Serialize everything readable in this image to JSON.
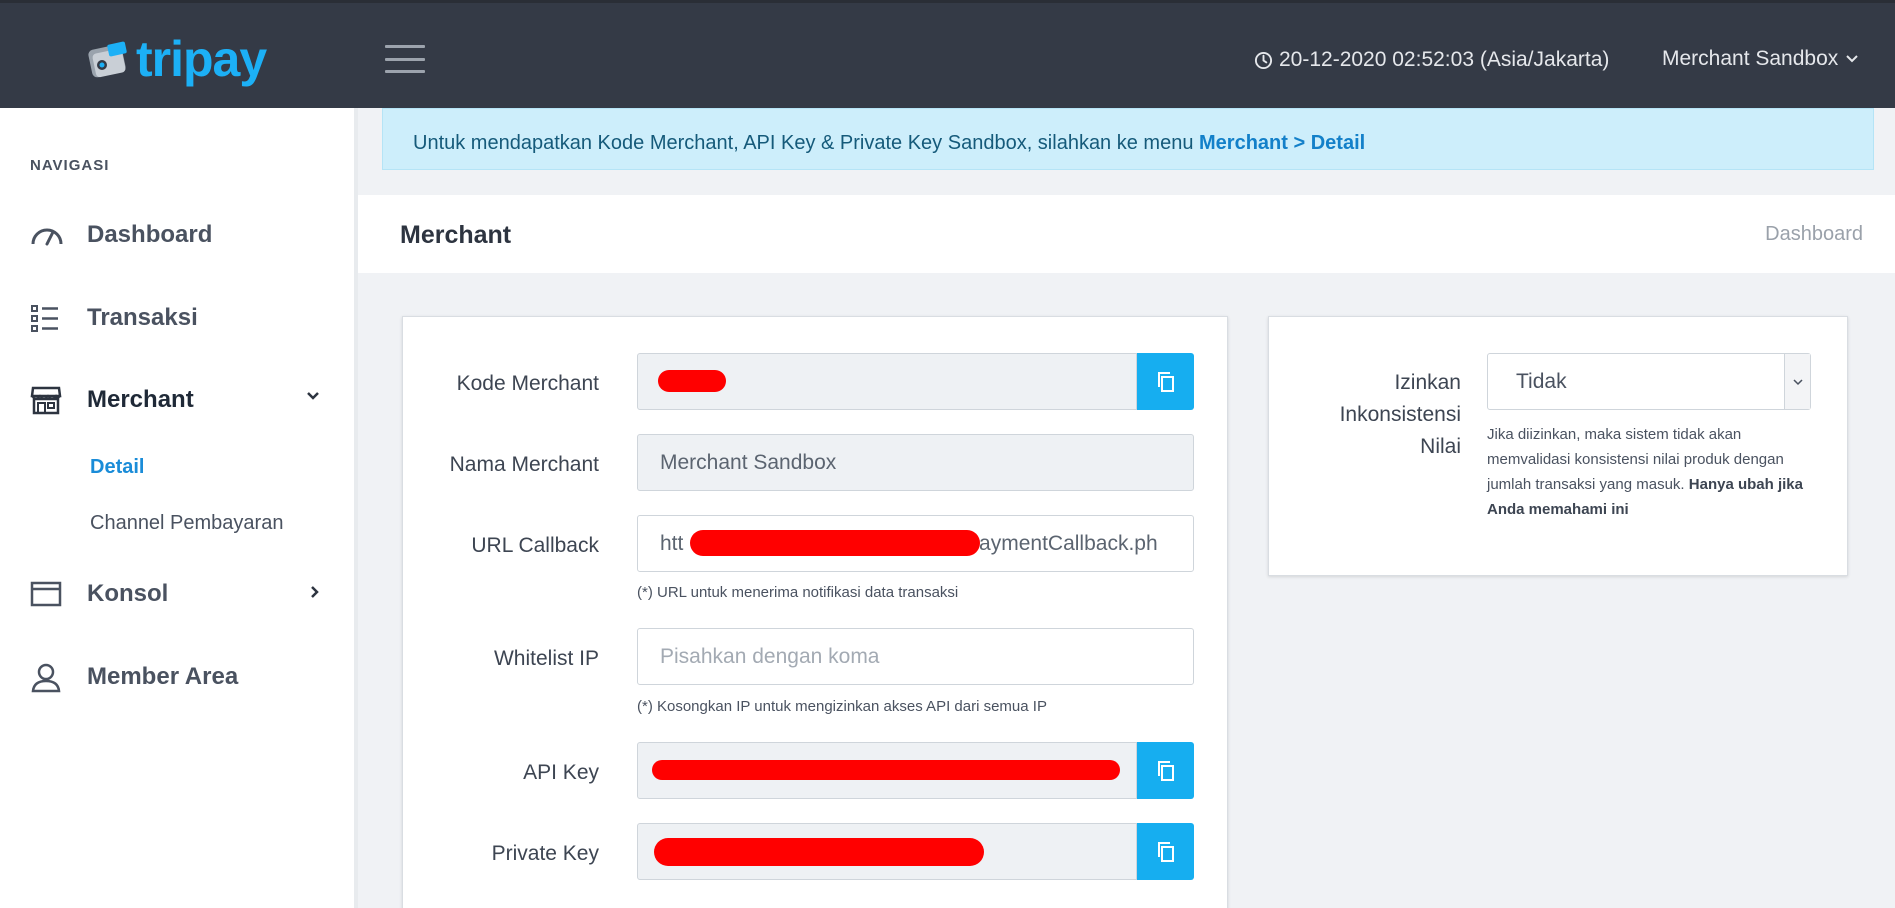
{
  "topbar": {
    "brand": "tripay",
    "datetime": "20-12-2020 02:52:03 (Asia/Jakarta)",
    "user_menu": "Merchant Sandbox"
  },
  "sidebar": {
    "heading": "NAVIGASI",
    "items": [
      {
        "label": "Dashboard",
        "icon": "speedometer-icon"
      },
      {
        "label": "Transaksi",
        "icon": "list-icon"
      },
      {
        "label": "Merchant",
        "icon": "store-icon",
        "expanded": true
      },
      {
        "label": "Konsol",
        "icon": "browser-window-icon"
      },
      {
        "label": "Member Area",
        "icon": "user-icon"
      }
    ],
    "merchant_sub": {
      "detail": "Detail",
      "channel": "Channel Pembayaran"
    }
  },
  "alert": {
    "text": "Untuk mendapatkan Kode Merchant, API Key & Private Key Sandbox, silahkan ke menu ",
    "link": "Merchant > Detail"
  },
  "page": {
    "title": "Merchant",
    "breadcrumb": "Dashboard"
  },
  "form": {
    "kode_merchant": {
      "label": "Kode Merchant"
    },
    "nama_merchant": {
      "label": "Nama Merchant",
      "value": "Merchant Sandbox"
    },
    "url_callback": {
      "label": "URL Callback",
      "value_prefix": "htt",
      "value_suffix": "paymentCallback.ph",
      "hint": "(*) URL untuk menerima notifikasi data transaksi"
    },
    "whitelist_ip": {
      "label": "Whitelist IP",
      "placeholder": "Pisahkan dengan koma",
      "hint": "(*) Kosongkan IP untuk mengizinkan akses API dari semua IP"
    },
    "api_key": {
      "label": "API Key"
    },
    "private_key": {
      "label": "Private Key"
    }
  },
  "settings": {
    "label_line1": "Izinkan",
    "label_line2": "Inkonsistensi",
    "label_line3": "Nilai",
    "selected": "Tidak",
    "help": "Jika diizinkan, maka sistem tidak akan memvalidasi konsistensi nilai produk dengan jumlah transaksi yang masuk. ",
    "help_bold": "Hanya ubah jika Anda memahami ini"
  },
  "colors": {
    "topbar": "#343a46",
    "accent": "#16aef0",
    "link": "#1a8cd8",
    "alert_bg": "#cdeefb",
    "redaction": "#ff0000"
  }
}
